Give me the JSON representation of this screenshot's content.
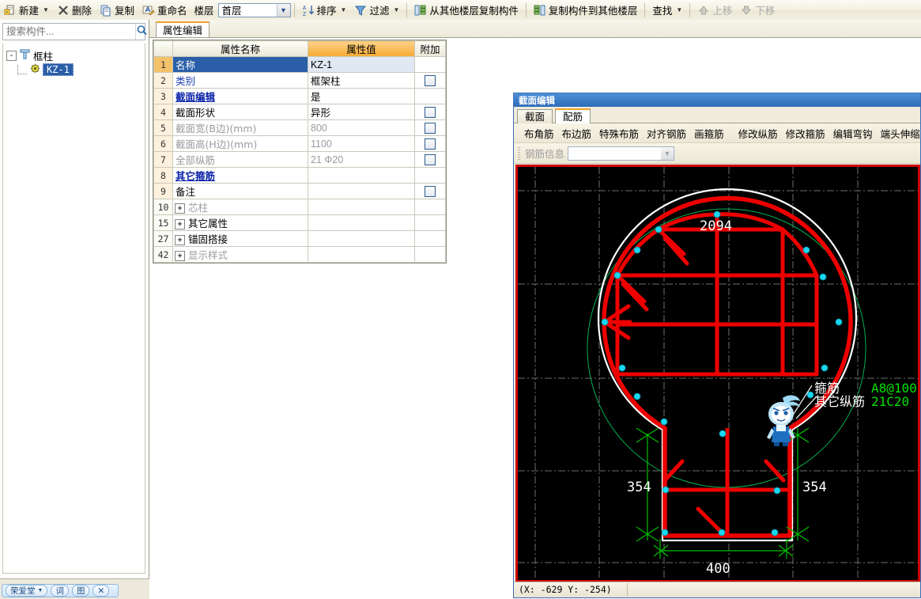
{
  "toolbar": {
    "buttons": [
      {
        "label": "新建",
        "icon": "new-file-icon",
        "dropdown": true,
        "disabled": false
      },
      {
        "label": "删除",
        "icon": "delete-x-icon",
        "dropdown": false,
        "disabled": false
      },
      {
        "label": "复制",
        "icon": "copy-icon",
        "dropdown": false,
        "disabled": false
      },
      {
        "label": "重命名",
        "icon": "rename-icon",
        "dropdown": false,
        "disabled": false
      }
    ],
    "floor_combo": {
      "label": "楼层",
      "value": "首层",
      "icon": "chevron-down-icon"
    },
    "buttons2": [
      {
        "label": "排序",
        "icon": "sort-az-icon",
        "dropdown": true,
        "disabled": false
      },
      {
        "label": "过滤",
        "icon": "filter-funnel-icon",
        "dropdown": true,
        "disabled": false
      },
      {
        "label": "从其他楼层复制构件",
        "icon": "copy-from-floor-icon",
        "dropdown": false,
        "disabled": false
      },
      {
        "label": "复制构件到其他楼层",
        "icon": "copy-to-floor-icon",
        "dropdown": false,
        "disabled": false
      },
      {
        "label": "查找",
        "icon": "find-icon",
        "dropdown": true,
        "disabled": false
      },
      {
        "label": "上移",
        "icon": "arrow-up-icon",
        "dropdown": false,
        "disabled": true
      },
      {
        "label": "下移",
        "icon": "arrow-down-icon",
        "dropdown": false,
        "disabled": true
      }
    ]
  },
  "sidebar": {
    "search": {
      "placeholder": "搜索构件...",
      "value": "",
      "icon": "search-icon"
    },
    "tree": {
      "root": {
        "label": "框柱",
        "icon": "column-icon",
        "expander": "-"
      },
      "child": {
        "label": "KZ-1",
        "icon": "gear-node-icon",
        "selected": true
      }
    }
  },
  "property_panel": {
    "tab_label": "属性编辑",
    "headers": {
      "index": "",
      "name": "属性名称",
      "value": "属性值",
      "attach": "附加"
    },
    "rows": [
      {
        "index": "1",
        "name": "名称",
        "value": "KZ-1",
        "attach": false,
        "selected": true,
        "name_style": "dark",
        "value_style": "dark",
        "expandable": false
      },
      {
        "index": "2",
        "name": "类别",
        "value": "框架柱",
        "attach": true,
        "selected": false,
        "name_style": "blue",
        "value_style": "dark",
        "expandable": false
      },
      {
        "index": "3",
        "name": "截面编辑",
        "value": "是",
        "attach": false,
        "selected": false,
        "name_style": "bluebold",
        "value_style": "dark",
        "expandable": false
      },
      {
        "index": "4",
        "name": "截面形状",
        "value": "异形",
        "attach": true,
        "selected": false,
        "name_style": "dark",
        "value_style": "dark",
        "expandable": false
      },
      {
        "index": "5",
        "name": "截面宽(B边)(mm)",
        "value": "800",
        "attach": true,
        "selected": false,
        "name_style": "gray",
        "value_style": "gray",
        "expandable": false
      },
      {
        "index": "6",
        "name": "截面高(H边)(mm)",
        "value": "1100",
        "attach": true,
        "selected": false,
        "name_style": "gray",
        "value_style": "gray",
        "expandable": false
      },
      {
        "index": "7",
        "name": "全部纵筋",
        "value": "21 Φ20",
        "attach": true,
        "selected": false,
        "name_style": "gray",
        "value_style": "gray",
        "expandable": false
      },
      {
        "index": "8",
        "name": "其它箍筋",
        "value": "",
        "attach": false,
        "selected": false,
        "name_style": "bluebold",
        "value_style": "dark",
        "expandable": false
      },
      {
        "index": "9",
        "name": "备注",
        "value": "",
        "attach": true,
        "selected": false,
        "name_style": "dark",
        "value_style": "dark",
        "expandable": false
      },
      {
        "index": "10",
        "name": "芯柱",
        "value": "",
        "attach": false,
        "selected": false,
        "name_style": "gray",
        "value_style": "dark",
        "expandable": true
      },
      {
        "index": "15",
        "name": "其它属性",
        "value": "",
        "attach": false,
        "selected": false,
        "name_style": "dark",
        "value_style": "dark",
        "expandable": true
      },
      {
        "index": "27",
        "name": "锚固搭接",
        "value": "",
        "attach": false,
        "selected": false,
        "name_style": "dark",
        "value_style": "dark",
        "expandable": true
      },
      {
        "index": "42",
        "name": "显示样式",
        "value": "",
        "attach": false,
        "selected": false,
        "name_style": "gray",
        "value_style": "dark",
        "expandable": true
      }
    ]
  },
  "section_dialog": {
    "title": "截面编辑",
    "tabs": [
      {
        "label": "截面",
        "active": false
      },
      {
        "label": "配筋",
        "active": true
      }
    ],
    "tools": [
      "布角筋",
      "布边筋",
      "特殊布筋",
      "对齐钢筋",
      "画箍筋",
      "修改纵筋",
      "修改箍筋",
      "编辑弯钩",
      "端头伸缩"
    ],
    "rebar_info": {
      "label": "钢筋信息",
      "value": "",
      "icon": "chevron-down-icon"
    },
    "status": {
      "coordinates": "(X: -629 Y: -254)"
    },
    "canvas": {
      "labels": [
        {
          "text": "2094",
          "color": "#ffffff"
        },
        {
          "text": "354",
          "color": "#ffffff"
        },
        {
          "text": "354",
          "color": "#ffffff"
        },
        {
          "text": "400",
          "color": "#ffffff"
        },
        {
          "text": "箍筋",
          "color": "#ffffff"
        },
        {
          "text": "其它纵筋",
          "color": "#ffffff"
        },
        {
          "text": "A8@100",
          "color": "#00e000"
        },
        {
          "text": "21C20",
          "color": "#00e000"
        }
      ],
      "colors": {
        "background": "#000000",
        "rebar": "#ee0000",
        "outline": "#ffffff",
        "dimension": "#00c000",
        "grid": "#707070",
        "bar_dot": "#40e0ff",
        "border": "#cf0000"
      },
      "mascot": "assistant-mascot-icon"
    }
  },
  "ime_bar": {
    "name": "荣爱堂",
    "buttons": [
      "词",
      "图",
      "✕"
    ],
    "icons": [
      "chevron-down-icon",
      "dictionary-icon",
      "toolbox-icon",
      "close-icon"
    ]
  }
}
